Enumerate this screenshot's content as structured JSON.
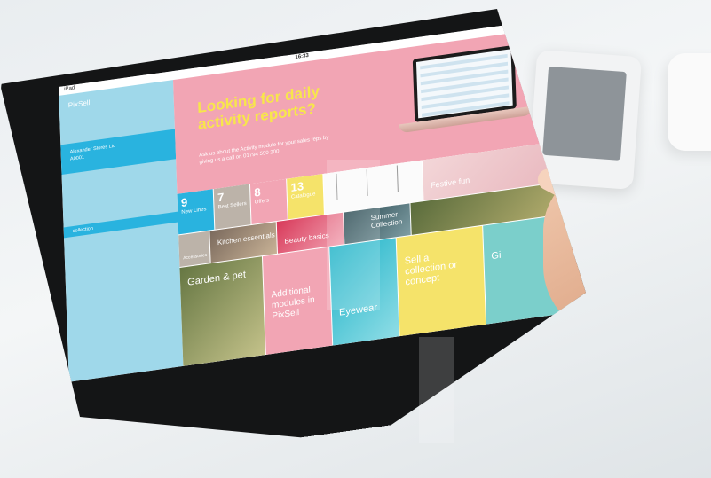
{
  "status_bar": {
    "carrier": "iPad",
    "time": "16:33",
    "battery": "100%"
  },
  "sidebar": {
    "brand": "PixSell",
    "account_line1": "Alexander Stores Ltd",
    "account_line2": "A0001",
    "highlighted_item": "collection"
  },
  "hero": {
    "headline": "Looking for daily activity reports?",
    "body": "Ask us about the Activity module for your sales reps by giving us a call on 01794 590 200"
  },
  "tiles": {
    "new_lines_count": "9",
    "new_lines_label": "New Lines",
    "best_sellers_count": "7",
    "best_sellers_label": "Best Sellers",
    "offers_count": "8",
    "offers_label": "Offers",
    "yellow_count": "13",
    "yellow_label": "Catalogue",
    "festive": "Festive fun",
    "beauty": "Beauty basics",
    "summer": "Summer Collection",
    "kitchen": "Kitchen essentials",
    "garden": "Garden & pet",
    "additional": "Additional modules in PixSell",
    "eyewear": "Eyewear",
    "collection": "Sell a collection or concept",
    "accessories": "Accessories",
    "gift": "Gi"
  },
  "colors": {
    "accent_blue": "#29b3df",
    "sidebar_blue": "#9fd8ea",
    "pink": "#f2a5b4",
    "yellow": "#f5e36a",
    "bezel": "#141516"
  }
}
